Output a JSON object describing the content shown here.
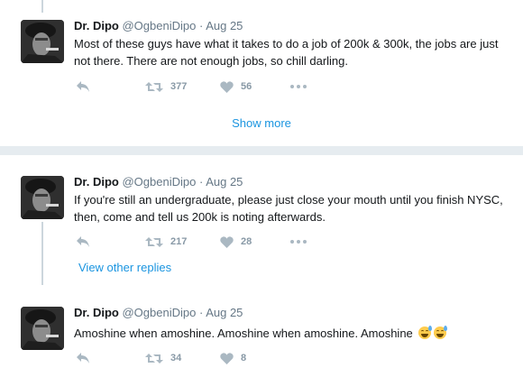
{
  "tweets": [
    {
      "name": "Dr. Dipo",
      "handle": "@OgbeniDipo",
      "separator": "·",
      "time": "Aug 25",
      "text": "Most of these guys have what it takes to do a job of 200k & 300k, the jobs are just not there. There are not enough jobs, so chill darling.",
      "retweets": "377",
      "likes": "56"
    },
    {
      "name": "Dr. Dipo",
      "handle": "@OgbeniDipo",
      "separator": "·",
      "time": "Aug 25",
      "text": "If you're still an undergraduate, please just close your mouth until you finish NYSC, then, come and tell us 200k is noting afterwards.",
      "retweets": "217",
      "likes": "28"
    },
    {
      "name": "Dr. Dipo",
      "handle": "@OgbeniDipo",
      "separator": "·",
      "time": "Aug 25",
      "text": "Amoshine when amoshine. Amoshine when amoshine. Amoshine",
      "retweets": "34",
      "likes": "8"
    }
  ],
  "show_more_label": "Show more",
  "view_replies_label": "View other replies",
  "icons": {
    "reply": "reply-icon",
    "retweet": "retweet-icon",
    "like": "heart-icon",
    "more": "more-icon",
    "emoji": "sweat-smile-emoji"
  },
  "colors": {
    "link": "#1b95e0",
    "muted": "#657786",
    "icon": "#aab8c2",
    "thread_line": "#ccd6dd",
    "background": "#e6ecf0"
  }
}
